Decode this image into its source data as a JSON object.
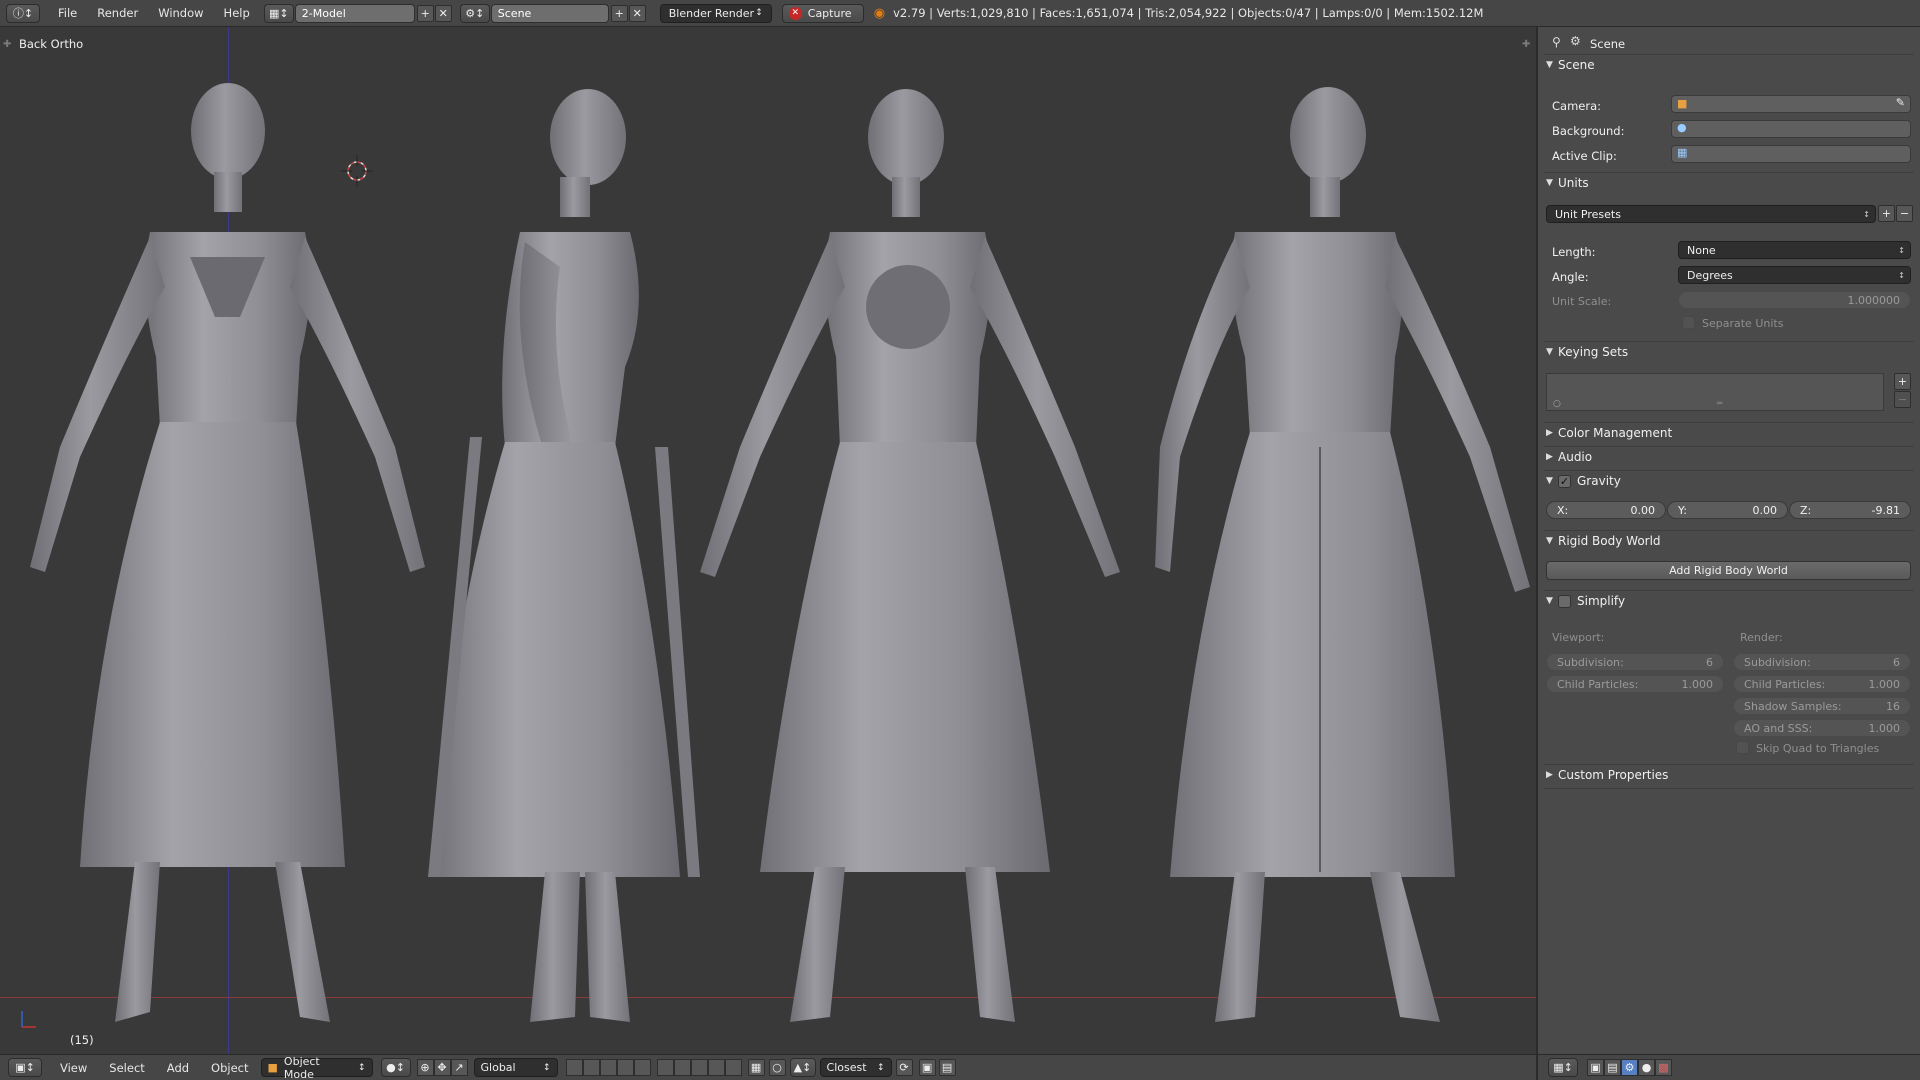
{
  "topbar": {
    "info_icon": "info-icon",
    "menus": [
      "File",
      "Render",
      "Window",
      "Help"
    ],
    "layout_name": "2-Model",
    "scene_name": "Scene",
    "render_engine": "Blender Render",
    "capture_label": "Capture",
    "stats": "v2.79 | Verts:1,029,810 | Faces:1,651,074 | Tris:2,054,922 | Objects:0/47 | Lamps:0/0 | Mem:1502.12M"
  },
  "viewport": {
    "view_label": "Back Ortho",
    "frame_label": "(15)"
  },
  "bottombar": {
    "menus": [
      "View",
      "Select",
      "Add",
      "Object"
    ],
    "mode": "Object Mode",
    "orientation": "Global",
    "snap_target": "Closest"
  },
  "panel": {
    "context_label": "Scene",
    "scene_section": {
      "title": "Scene",
      "camera_label": "Camera:",
      "background_label": "Background:",
      "active_clip_label": "Active Clip:"
    },
    "units_section": {
      "title": "Units",
      "presets": "Unit Presets",
      "length_label": "Length:",
      "length_value": "None",
      "angle_label": "Angle:",
      "angle_value": "Degrees",
      "unit_scale_label": "Unit Scale:",
      "unit_scale_value": "1.000000",
      "separate_units_label": "Separate Units"
    },
    "keying_sets_title": "Keying Sets",
    "color_management_title": "Color Management",
    "audio_title": "Audio",
    "gravity": {
      "title": "Gravity",
      "checked": true,
      "x_label": "X:",
      "x_value": "0.00",
      "y_label": "Y:",
      "y_value": "0.00",
      "z_label": "Z:",
      "z_value": "-9.81"
    },
    "rigid_body": {
      "title": "Rigid Body World",
      "button": "Add Rigid Body World"
    },
    "simplify": {
      "title": "Simplify",
      "checked": false,
      "viewport_label": "Viewport:",
      "render_label": "Render:",
      "vp_subdivision_label": "Subdivision:",
      "vp_subdivision_value": "6",
      "vp_child_particles_label": "Child Particles:",
      "vp_child_particles_value": "1.000",
      "r_subdivision_label": "Subdivision:",
      "r_subdivision_value": "6",
      "r_child_particles_label": "Child Particles:",
      "r_child_particles_value": "1.000",
      "r_shadow_samples_label": "Shadow Samples:",
      "r_shadow_samples_value": "16",
      "r_ao_sss_label": "AO and SSS:",
      "r_ao_sss_value": "1.000",
      "skip_quad_label": "Skip Quad to Triangles"
    },
    "custom_properties_title": "Custom Properties"
  },
  "colors": {
    "viewport_bg": "#393939",
    "panel_bg": "#4a4a4a",
    "header_bg": "#464646",
    "model_gray": "#8a8a90"
  }
}
